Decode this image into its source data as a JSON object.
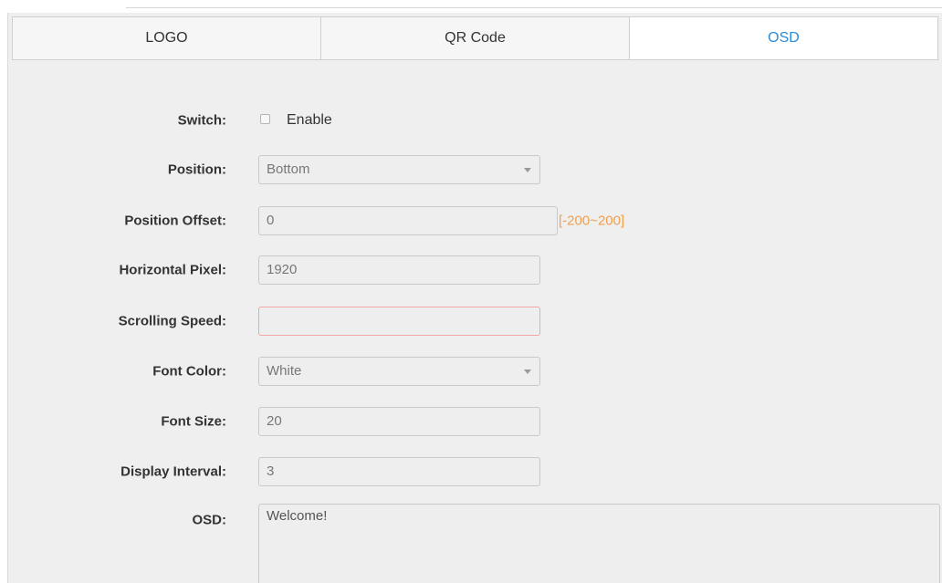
{
  "tabs": [
    {
      "label": "LOGO",
      "active": false
    },
    {
      "label": "QR Code",
      "active": false
    },
    {
      "label": "OSD",
      "active": true
    }
  ],
  "colors": {
    "active_tab": "#2b8cd9",
    "range_hint": "#f0a04b",
    "error_border": "#f2a6a6"
  },
  "form": {
    "switch": {
      "label": "Switch:",
      "checkbox_label": "Enable",
      "checked": false
    },
    "position": {
      "label": "Position:",
      "value": "Bottom"
    },
    "position_offset": {
      "label": "Position Offset:",
      "value": "0",
      "range": "[-200~200]"
    },
    "horizontal_pixel": {
      "label": "Horizontal Pixel:",
      "value": "1920"
    },
    "scrolling_speed": {
      "label": "Scrolling Speed:",
      "value": ""
    },
    "font_color": {
      "label": "Font Color:",
      "value": "White"
    },
    "font_size": {
      "label": "Font Size:",
      "value": "20"
    },
    "display_interval": {
      "label": "Display Interval:",
      "value": "3"
    },
    "osd": {
      "label": "OSD:",
      "value": "Welcome!"
    }
  }
}
